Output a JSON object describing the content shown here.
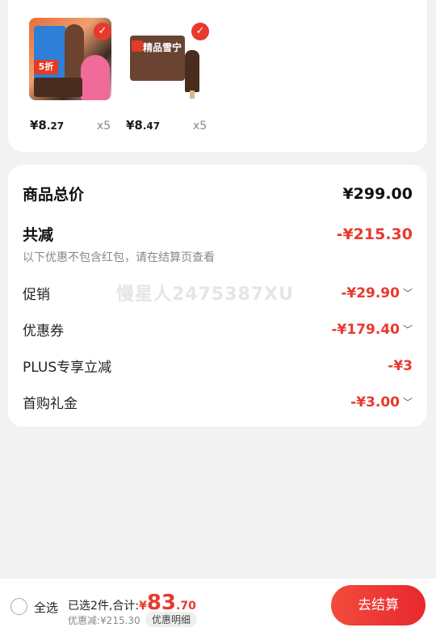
{
  "products": [
    {
      "price_int": "¥8",
      "price_dec": ".27",
      "qty": "x5",
      "checked": true
    },
    {
      "price_int": "¥8",
      "price_dec": ".47",
      "qty": "x5",
      "checked": true
    }
  ],
  "summary": {
    "total_label": "商品总价",
    "total_value": "¥299.00",
    "reduce_label": "共减",
    "reduce_value": "-¥215.30",
    "note": "以下优惠不包含红包，请在结算页查看",
    "watermark": "慢星人2475387XU",
    "items": [
      {
        "label": "促销",
        "value": "-¥29.90",
        "expandable": true
      },
      {
        "label": "优惠券",
        "value": "-¥179.40",
        "expandable": true
      },
      {
        "label": "PLUS专享立减",
        "value": "-¥3",
        "expandable": false
      },
      {
        "label": "首购礼金",
        "value": "-¥3.00",
        "expandable": true
      }
    ]
  },
  "bottom": {
    "select_all": "全选",
    "selected_text": "已选2件,合计:",
    "total_cur": "¥",
    "total_int": "83",
    "total_dec": ".70",
    "discount": "优惠减:¥215.30",
    "detail_btn": "优惠明细",
    "checkout": "去结算"
  },
  "colors": {
    "accent": "#e8392e",
    "background": "#f2f2f2"
  }
}
